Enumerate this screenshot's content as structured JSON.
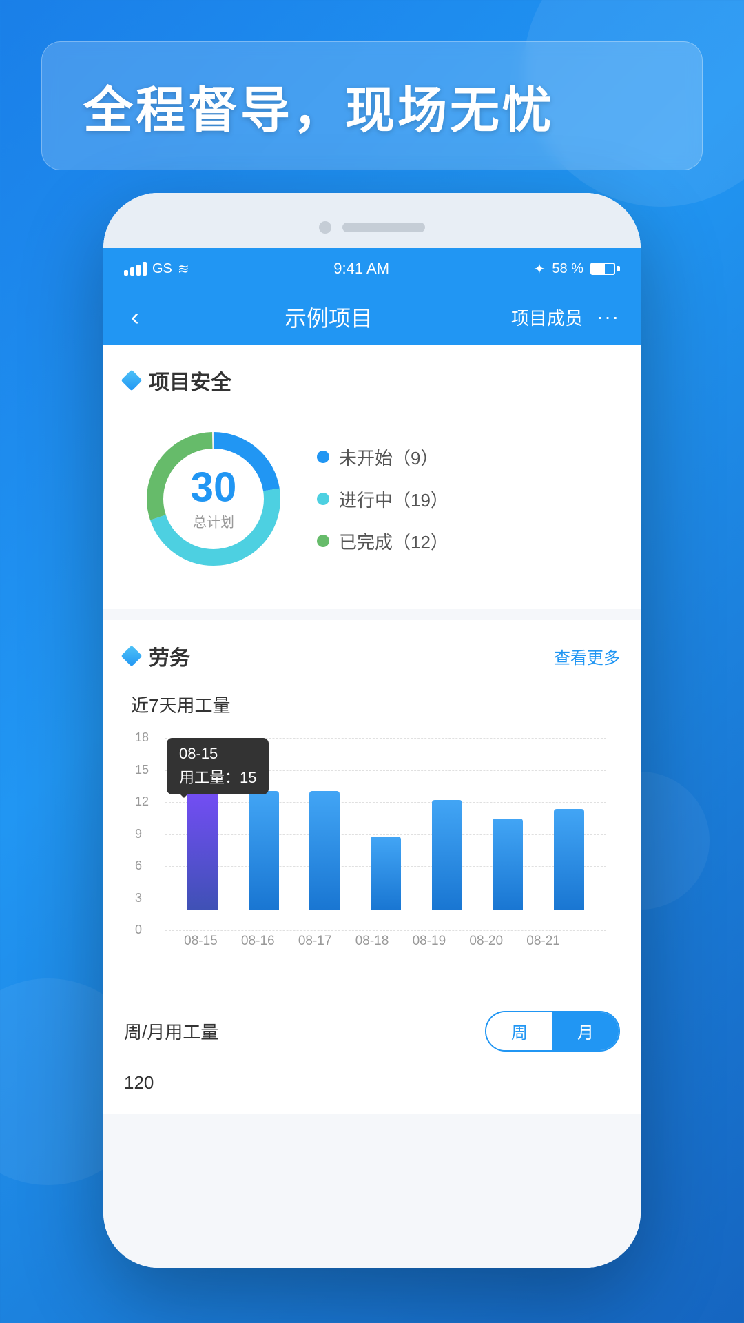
{
  "background": {
    "gradient_start": "#1a7fe8",
    "gradient_end": "#1565c0"
  },
  "header": {
    "banner_text": "全程督导，现场无忧"
  },
  "phone": {
    "status_bar": {
      "carrier": "GS",
      "wifi": true,
      "time": "9:41 AM",
      "bluetooth": true,
      "battery": "58 %"
    },
    "nav_bar": {
      "back_icon": "‹",
      "title": "示例项目",
      "right_label": "项目成员",
      "more_icon": "···"
    },
    "sections": {
      "project_safety": {
        "title": "项目安全",
        "donut": {
          "total": "30",
          "label": "总计划",
          "not_started": 9,
          "in_progress": 19,
          "completed": 12
        },
        "legend": [
          {
            "color": "#2196f3",
            "label": "未开始（9）"
          },
          {
            "color": "#4dd0e1",
            "label": "进行中（19）"
          },
          {
            "color": "#66bb6a",
            "label": "已完成（12）"
          }
        ]
      },
      "labor": {
        "title": "劳务",
        "link": "查看更多",
        "chart_title": "近7天用工量",
        "y_labels": [
          "18",
          "15",
          "12",
          "9",
          "6",
          "3",
          "0"
        ],
        "bars": [
          {
            "date": "08-15",
            "value": 15,
            "height_pct": 83,
            "highlighted": true
          },
          {
            "date": "08-16",
            "value": 13,
            "height_pct": 72,
            "highlighted": false
          },
          {
            "date": "08-17",
            "value": 13,
            "height_pct": 72,
            "highlighted": false
          },
          {
            "date": "08-18",
            "value": 8,
            "height_pct": 44,
            "highlighted": false
          },
          {
            "date": "08-19",
            "value": 12,
            "height_pct": 67,
            "highlighted": false
          },
          {
            "date": "08-20",
            "value": 10,
            "height_pct": 56,
            "highlighted": false
          },
          {
            "date": "08-21",
            "value": 11,
            "height_pct": 61,
            "highlighted": false
          }
        ],
        "tooltip": {
          "date": "08-15",
          "label": "用工量：",
          "value": "15"
        },
        "period": {
          "label": "周/月用工量",
          "options": [
            "周",
            "月"
          ],
          "active": "月"
        },
        "sub_value": "120"
      }
    }
  }
}
